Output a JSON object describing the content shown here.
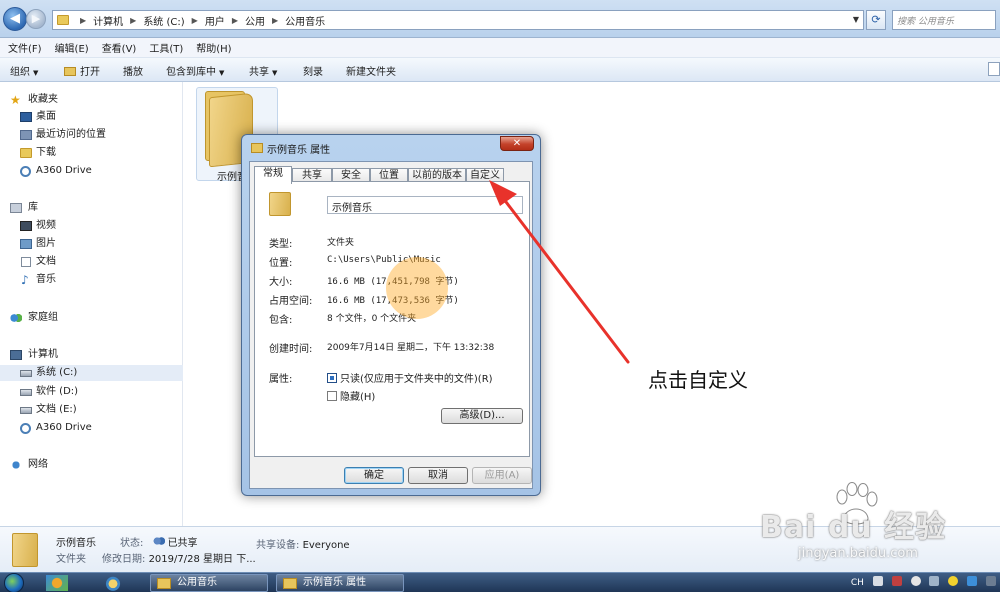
{
  "address": {
    "crumbs": [
      "计算机",
      "系统 (C:)",
      "用户",
      "公用",
      "公用音乐"
    ],
    "search_placeholder": "搜索 公用音乐"
  },
  "menu": [
    "文件(F)",
    "编辑(E)",
    "查看(V)",
    "工具(T)",
    "帮助(H)"
  ],
  "commands": [
    "组织",
    "打开",
    "播放",
    "包含到库中",
    "共享",
    "刻录",
    "新建文件夹"
  ],
  "nav": {
    "favorites": "收藏夹",
    "fav_items": [
      "桌面",
      "最近访问的位置",
      "下载",
      "A360 Drive"
    ],
    "libraries": "库",
    "lib_items": [
      "视频",
      "图片",
      "文档",
      "音乐"
    ],
    "homegroup": "家庭组",
    "computer": "计算机",
    "drives": [
      "系统 (C:)",
      "软件 (D:)",
      "文档 (E:)",
      "A360 Drive"
    ],
    "network": "网络"
  },
  "content": {
    "folder_label": "示例音"
  },
  "details": {
    "name": "示例音乐",
    "type": "文件夹",
    "state_label": "状态:",
    "state_value": "已共享",
    "date_label": "修改日期:",
    "date_value": "2019/7/28 星期日 下...",
    "share_label": "共享设备:",
    "share_value": "Everyone"
  },
  "taskbar": {
    "tasks": [
      "公用音乐",
      "示例音乐 属性"
    ],
    "tray_lang": "CH"
  },
  "dialog": {
    "title": "示例音乐 属性",
    "close": "✕",
    "tabs": [
      "常规",
      "共享",
      "安全",
      "位置",
      "以前的版本",
      "自定义"
    ],
    "folder_name": "示例音乐",
    "props": [
      {
        "label": "类型:",
        "value": "文件夹"
      },
      {
        "label": "位置:",
        "value": "C:\\Users\\Public\\Music"
      },
      {
        "label": "大小:",
        "value": "16.6 MB (17,451,798 字节)"
      },
      {
        "label": "占用空间:",
        "value": "16.6 MB (17,473,536 字节)"
      },
      {
        "label": "包含:",
        "value": "8 个文件，0 个文件夹"
      },
      {
        "label": "创建时间:",
        "value": "2009年7月14日 星期二，下午 13:32:38"
      }
    ],
    "attr_label": "属性:",
    "readonly": "只读(仅应用于文件夹中的文件)(R)",
    "hidden": "隐藏(H)",
    "advanced": "高级(D)...",
    "ok": "确定",
    "cancel": "取消",
    "apply": "应用(A)"
  },
  "annotation": "点击自定义",
  "watermark": {
    "main": "Bai du 经验",
    "sub": "jingyan.baidu.com"
  },
  "colors": {
    "arrow": "#e8322b",
    "cursor_highlight": "#ffaa28",
    "title_bar": "#b8d2ee"
  }
}
